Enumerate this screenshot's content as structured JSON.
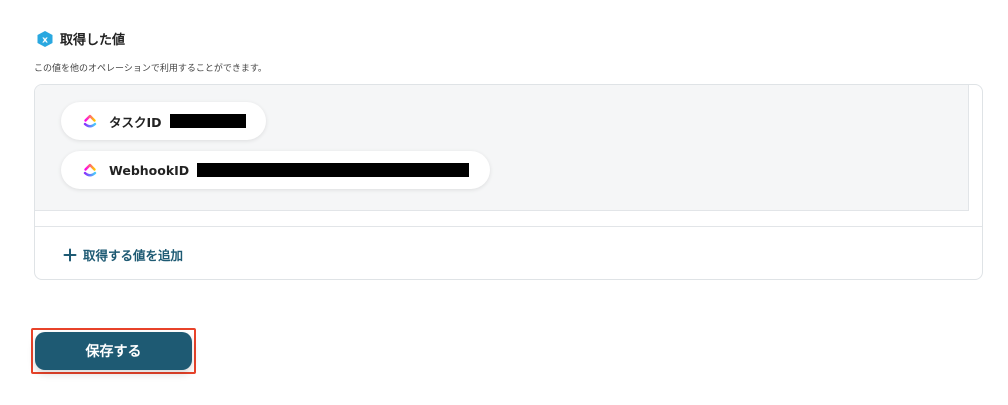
{
  "section": {
    "title": "取得した値",
    "description": "この値を他のオペレーションで利用することができます。",
    "icon": "x-badge-icon"
  },
  "values": [
    {
      "label": "タスクID",
      "icon": "clickup-icon",
      "value_redacted": true
    },
    {
      "label": "WebhookID",
      "icon": "clickup-icon",
      "value_redacted": true
    }
  ],
  "add_value": {
    "label": "取得する値を追加",
    "icon": "plus-icon"
  },
  "save_button": {
    "label": "保存する"
  },
  "colors": {
    "primary": "#1e5a73",
    "highlight_border": "#e8432a",
    "icon_badge": "#2aa8e0"
  }
}
